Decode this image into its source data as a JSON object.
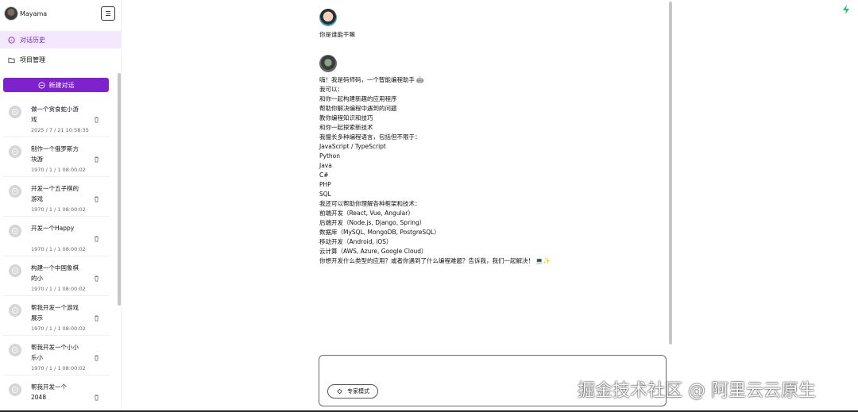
{
  "user": {
    "name": "Mayama"
  },
  "nav": {
    "history_label": "对话历史",
    "projects_label": "项目管理",
    "new_chat_label": "新建对话"
  },
  "history": [
    {
      "title": "做一个贪食蛇小游戏",
      "time": "2025 / 7 / 21 10:58:35"
    },
    {
      "title": "制作一个俄罗斯方块游",
      "time": "1970 / 1 / 1 08:00:02"
    },
    {
      "title": "开发一个五子棋的游戏",
      "time": "1970 / 1 / 1 08:00:02"
    },
    {
      "title": "开发一个Happy",
      "time": "1970 / 1 / 1 08:00:02"
    },
    {
      "title": "构建一个中国象棋的小",
      "time": "1970 / 1 / 1 08:00:02"
    },
    {
      "title": "帮我开发一个游戏展示",
      "time": "1970 / 1 / 1 08:00:02"
    },
    {
      "title": "帮我开发一个小小乐小",
      "time": "1970 / 1 / 1 08:00:02"
    },
    {
      "title": "帮我开发一个2048",
      "time": ""
    }
  ],
  "chat": {
    "user_message": "你是谁能干嘛",
    "bot_lines": [
      "嗨！我是码师码，一个智能编程助手 🤖",
      "我可以：",
      "和你一起构建新趣的应用程序",
      "帮助你解决编程中遇到的问题",
      "教你编程知识和技巧",
      "和你一起探索新技术",
      "我擅长多种编程语言，包括但不限于：",
      "JavaScript / TypeScript",
      "Python",
      "Java",
      "C#",
      "PHP",
      "SQL",
      "我还可以帮助你理解各种框架和技术：",
      "前端开发（React, Vue, Angular）",
      "后端开发（Node.js, Django, Spring）",
      "数据库（MySQL, MongoDB, PostgreSQL）",
      "移动开发（Android, iOS）",
      "云计算（AWS, Azure, Google Cloud）",
      "你想开发什么类型的应用？或者你遇到了什么编程难题？告诉我，我们一起解决！ 💻✨"
    ]
  },
  "input": {
    "placeholder": "",
    "expert_mode_label": "专家模式"
  },
  "watermark": "掘金技术社区 @ 阿里云云原生",
  "colors": {
    "accent": "#7e22ce",
    "active_bg": "#f3e8ff",
    "bolt": "#22c55e"
  }
}
